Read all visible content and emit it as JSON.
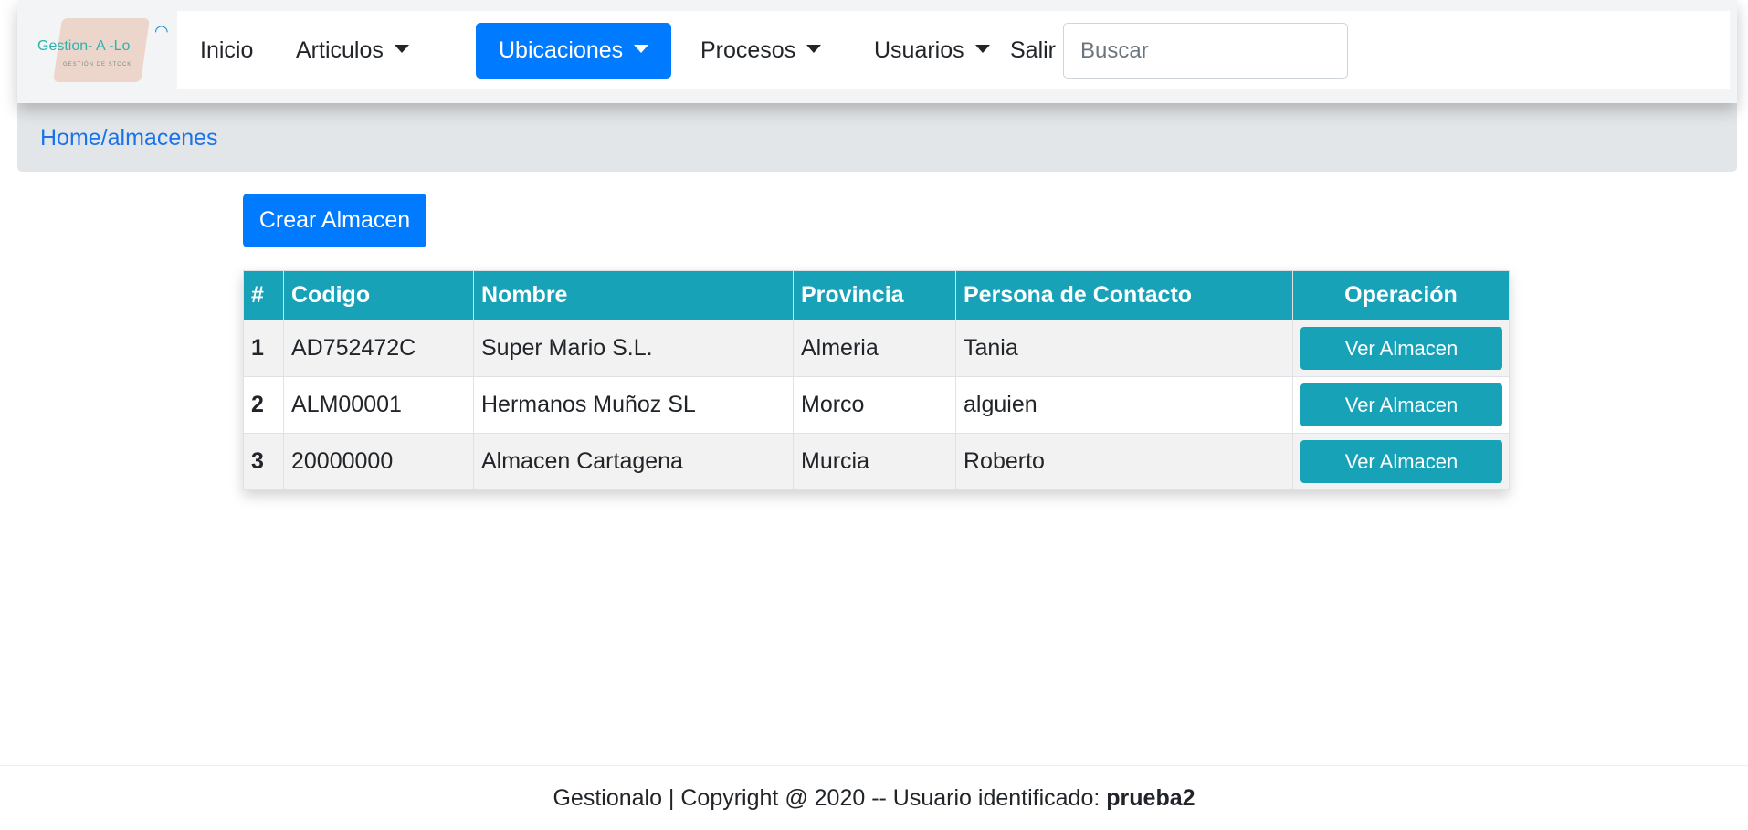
{
  "logo": {
    "text": "Gestion- A -Lo",
    "subtext": "GESTIÓN DE STOCK"
  },
  "nav": {
    "items": [
      {
        "label": "Inicio",
        "dropdown": false,
        "active": false
      },
      {
        "label": "Articulos",
        "dropdown": true,
        "active": false
      },
      {
        "label": "Ubicaciones",
        "dropdown": true,
        "active": true
      },
      {
        "label": "Procesos",
        "dropdown": true,
        "active": false
      },
      {
        "label": "Usuarios",
        "dropdown": true,
        "active": false
      },
      {
        "label": "Salir",
        "dropdown": false,
        "active": false
      }
    ],
    "search_placeholder": "Buscar"
  },
  "breadcrumb": "Home/almacenes",
  "create_button": "Crear Almacen",
  "table": {
    "headers": [
      "#",
      "Codigo",
      "Nombre",
      "Provincia",
      "Persona de Contacto",
      "Operación"
    ],
    "rows": [
      {
        "idx": "1",
        "codigo": "AD752472C",
        "nombre": "Super Mario S.L.",
        "provincia": "Almeria",
        "contacto": "Tania",
        "action": "Ver Almacen"
      },
      {
        "idx": "2",
        "codigo": "ALM00001",
        "nombre": "Hermanos Muñoz SL",
        "provincia": "Morco",
        "contacto": "alguien",
        "action": "Ver Almacen"
      },
      {
        "idx": "3",
        "codigo": "20000000",
        "nombre": "Almacen Cartagena",
        "provincia": "Murcia",
        "contacto": "Roberto",
        "action": "Ver Almacen"
      }
    ]
  },
  "footer": {
    "text": "Gestionalo | Copyright @ 2020 -- Usuario identificado: ",
    "user": "prueba2"
  },
  "colors": {
    "primary": "#007bff",
    "info": "#17a2b8",
    "breadcrumb_bg": "#e3e6e9",
    "link": "#1a73e8"
  }
}
